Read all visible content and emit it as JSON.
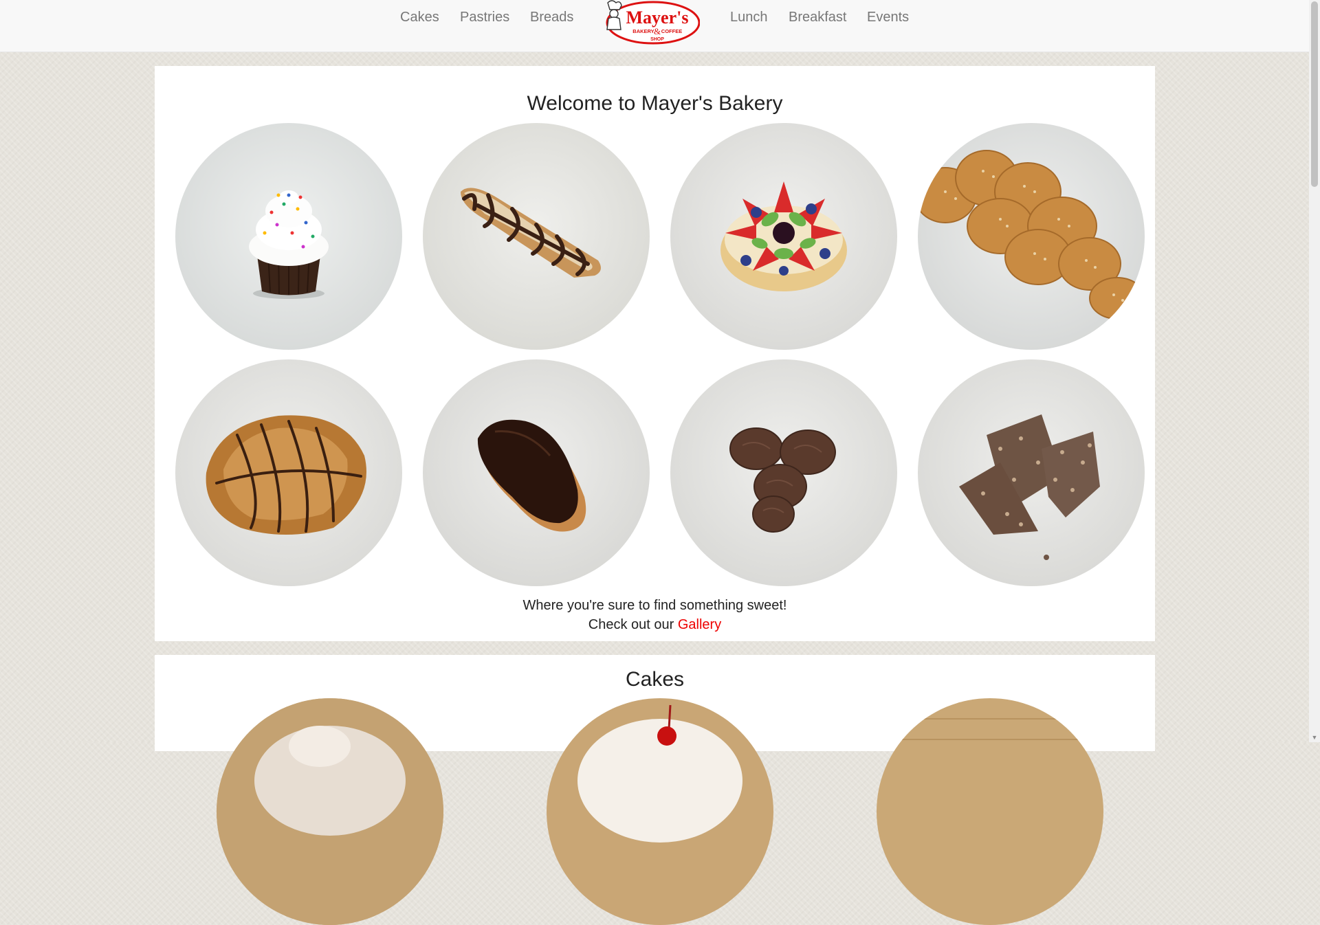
{
  "nav": {
    "left": [
      "Cakes",
      "Pastries",
      "Breads"
    ],
    "right": [
      "Lunch",
      "Breakfast",
      "Events"
    ],
    "logo": {
      "name": "Mayer's",
      "sub1": "BAKERY",
      "amp": "&",
      "sub2": "COFFEE",
      "sub3": "SHOP"
    }
  },
  "welcome": {
    "title": "Welcome to Mayer's Bakery",
    "tagline": "Where you're sure to find something sweet!",
    "gallery_prefix": "Check out our ",
    "gallery_link": "Gallery"
  },
  "gallery_items": [
    {
      "icon": "cupcake-image"
    },
    {
      "icon": "almond-chocolate-pastry-image"
    },
    {
      "icon": "fruit-tart-image"
    },
    {
      "icon": "braided-challah-bread-image"
    },
    {
      "icon": "chocolate-drizzled-croissant-image"
    },
    {
      "icon": "chocolate-eclair-image"
    },
    {
      "icon": "chocolate-cookies-image"
    },
    {
      "icon": "toffee-bark-image"
    }
  ],
  "cakes": {
    "title": "Cakes"
  },
  "colors": {
    "accent": "#e00000",
    "nav_text": "#777777",
    "panel_bg": "#ffffff"
  }
}
